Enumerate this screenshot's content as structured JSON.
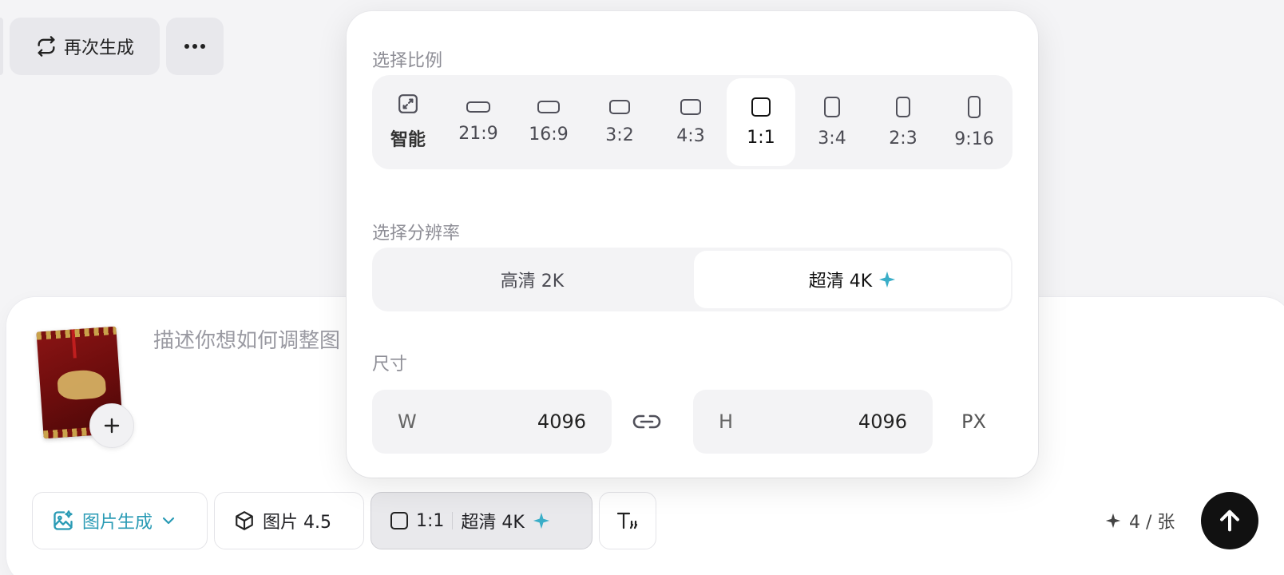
{
  "toolbar": {
    "regenerate_label": "再次生成",
    "more_icon": "more-icon"
  },
  "composer": {
    "prompt_placeholder": "描述你想如何调整图",
    "add_icon": "plus-icon"
  },
  "bottom_bar": {
    "mode_label": "图片生成",
    "model_label": "图片 4.5",
    "ratio_value": "1:1",
    "resolution_value": "超清 4K",
    "text_tool_icon": "text-format-icon",
    "credits_label": "4 / 张",
    "send_icon": "arrow-up-icon"
  },
  "popover": {
    "ratio_title": "选择比例",
    "ratios": [
      {
        "label": "智能",
        "icon": "auto-ratio-icon"
      },
      {
        "label": "21:9"
      },
      {
        "label": "16:9"
      },
      {
        "label": "3:2"
      },
      {
        "label": "4:3"
      },
      {
        "label": "1:1"
      },
      {
        "label": "3:4"
      },
      {
        "label": "2:3"
      },
      {
        "label": "9:16"
      }
    ],
    "selected_ratio": "1:1",
    "resolution_title": "选择分辨率",
    "resolutions": [
      {
        "label": "高清 2K"
      },
      {
        "label": "超清 4K"
      }
    ],
    "selected_resolution": "超清 4K",
    "size_title": "尺寸",
    "width_label": "W",
    "width_value": "4096",
    "height_label": "H",
    "height_value": "4096",
    "unit": "PX"
  },
  "colors": {
    "accent": "#2a9bb5",
    "sparkle": "#3aaec8",
    "send_button": "#111111"
  }
}
